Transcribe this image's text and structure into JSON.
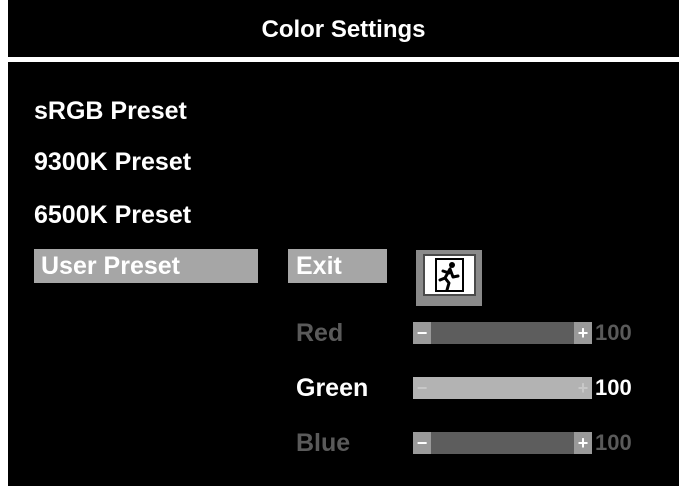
{
  "title": "Color Settings",
  "presets": [
    {
      "label": "sRGB Preset"
    },
    {
      "label": "9300K Preset"
    },
    {
      "label": "6500K Preset"
    },
    {
      "label": "User Preset"
    }
  ],
  "exit": {
    "label": "Exit",
    "icon": "emergency-exit-icon"
  },
  "channels": [
    {
      "label": "Red",
      "value": "100",
      "symbol_minus": "−",
      "symbol_plus": "+"
    },
    {
      "label": "Green",
      "value": "100",
      "symbol_minus": "−",
      "symbol_plus": "+"
    },
    {
      "label": "Blue",
      "value": "100",
      "symbol_minus": "−",
      "symbol_plus": "+"
    }
  ],
  "colors": {
    "background": "#000000",
    "highlight": "#a6a6a6",
    "text": "#ffffff",
    "dimmed": "#5a5a5a"
  }
}
